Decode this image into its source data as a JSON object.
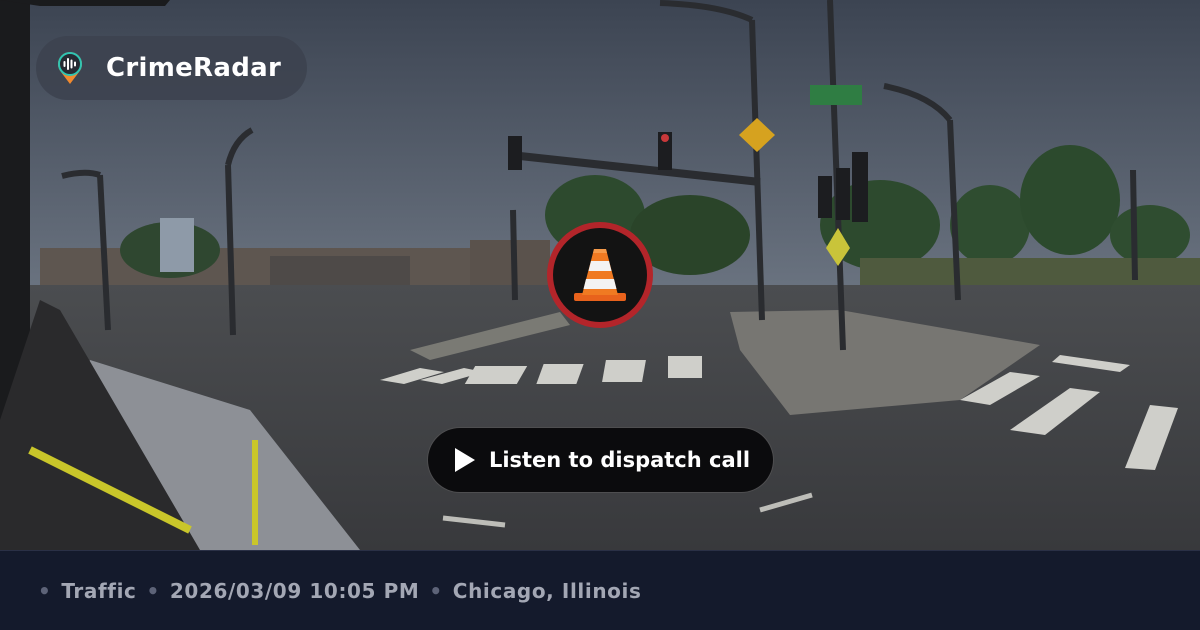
{
  "brand": {
    "name": "CrimeRadar",
    "logo_icon": "radar-pin-icon"
  },
  "incident": {
    "icon": "traffic-cone-icon",
    "accent": "#b3252a"
  },
  "actions": {
    "listen_label": "Listen to dispatch call",
    "listen_icon": "play-icon"
  },
  "meta": {
    "category": "Traffic",
    "datetime": "2026/03/09 10:05 PM",
    "location": "Chicago, Illinois",
    "separator": "•"
  },
  "scene": {
    "description_icon": "street-photo"
  }
}
